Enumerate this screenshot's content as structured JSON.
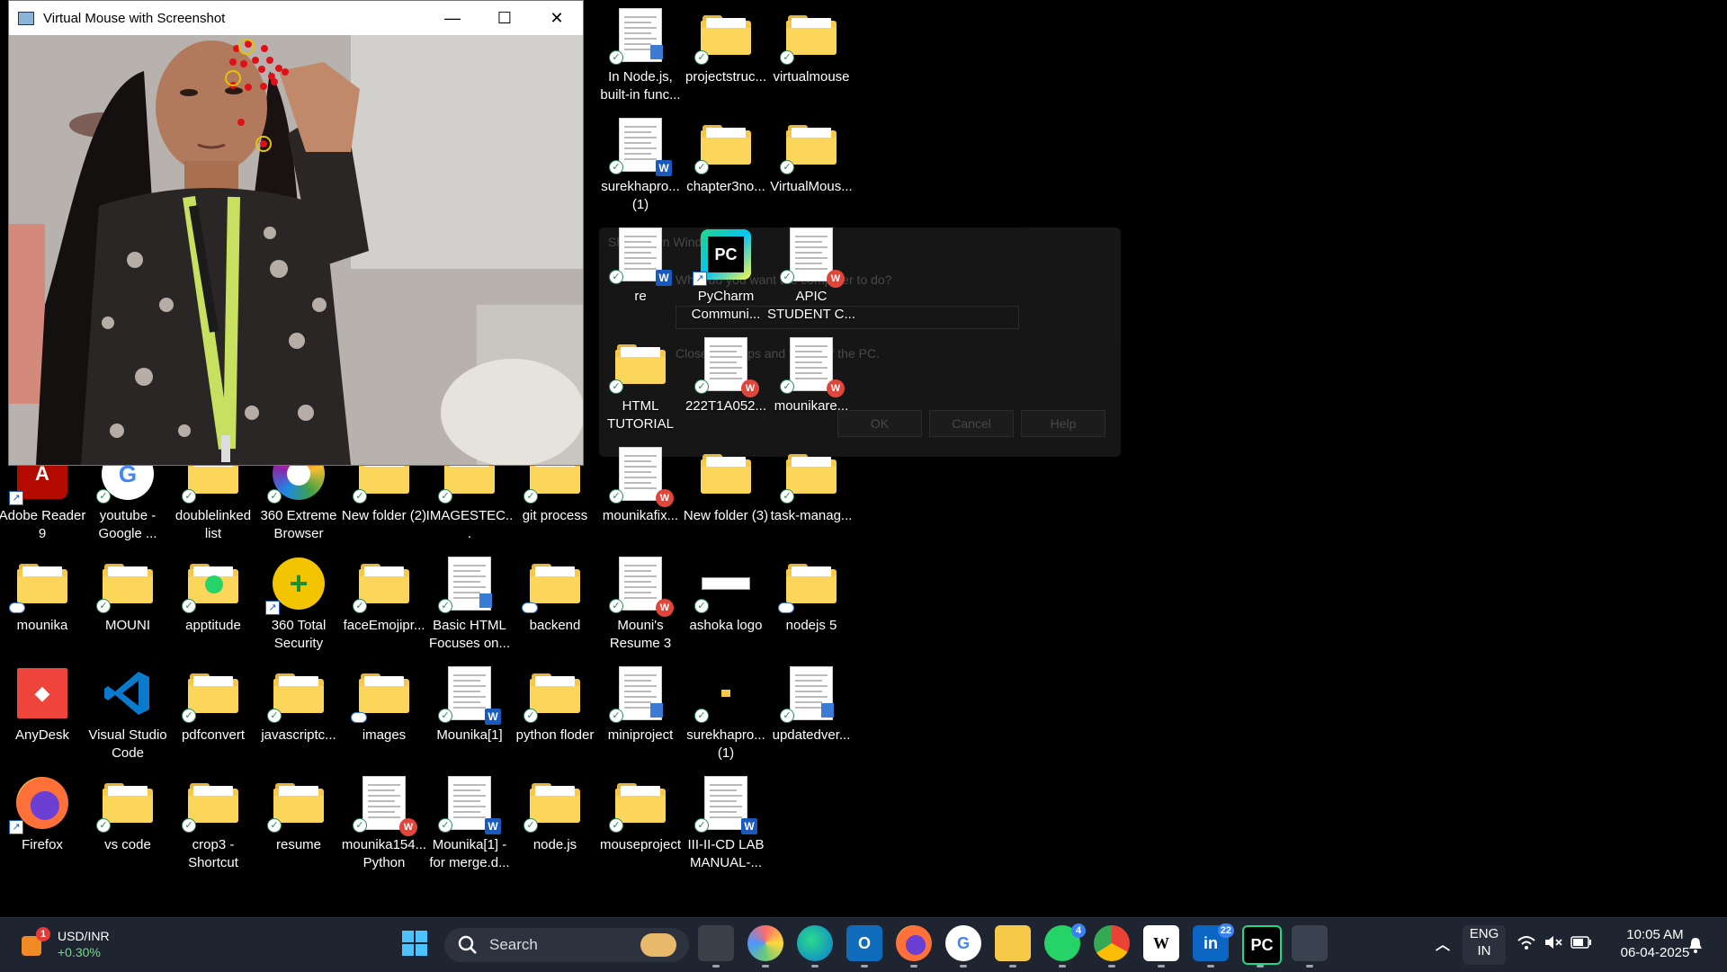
{
  "window": {
    "title": "Virtual Mouse with Screenshot",
    "buttons": {
      "minimize": "—",
      "maximize": "☐",
      "close": "✕"
    }
  },
  "dialog": {
    "title": "Shut Down Windows",
    "question": "What do you want the computer to do?",
    "description": "Closes all apps and turns off the PC.",
    "ok": "OK",
    "cancel": "Cancel",
    "help": "Help"
  },
  "desktop_icons": [
    {
      "label": "In Node.js, built-in func...",
      "kind": "doc-note",
      "status": "check"
    },
    {
      "label": "projectstruc...",
      "kind": "folder",
      "status": "check"
    },
    {
      "label": "virtualmouse",
      "kind": "folder",
      "status": "check"
    },
    {
      "label": "surekhapro... (1)",
      "kind": "doc-word",
      "status": "check"
    },
    {
      "label": "chapter3no...",
      "kind": "folder",
      "status": "check"
    },
    {
      "label": "VirtualMous...",
      "kind": "folder",
      "status": "check"
    },
    {
      "label": "re",
      "kind": "doc-word",
      "status": "check"
    },
    {
      "label": "PyCharm Communi...",
      "kind": "pycharm",
      "status": "shortcut"
    },
    {
      "label": "APIC STUDENT C...",
      "kind": "doc-wps",
      "status": "check"
    },
    {
      "label": "HTML TUTORIAL",
      "kind": "folder",
      "status": "check"
    },
    {
      "label": "222T1A052...",
      "kind": "doc-wps",
      "status": "check"
    },
    {
      "label": "mounikare...",
      "kind": "doc-wps",
      "status": "check"
    },
    {
      "label": "Adobe Reader 9",
      "kind": "adobe",
      "status": "shortcut"
    },
    {
      "label": "youtube - Google ...",
      "kind": "google",
      "status": "check"
    },
    {
      "label": "doublelinked list",
      "kind": "folder",
      "status": "check"
    },
    {
      "label": "360 Extreme Browser",
      "kind": "browser360",
      "status": "check"
    },
    {
      "label": "New folder (2)",
      "kind": "folder",
      "status": "check"
    },
    {
      "label": "IMAGESTEC...",
      "kind": "folder",
      "status": "check"
    },
    {
      "label": "git process",
      "kind": "folder",
      "status": "check"
    },
    {
      "label": "mounikafix...",
      "kind": "doc-wps",
      "status": "check"
    },
    {
      "label": "New folder (3)",
      "kind": "folder",
      "status": "none"
    },
    {
      "label": "task-manag...",
      "kind": "folder",
      "status": "check"
    },
    {
      "label": "mounika",
      "kind": "folder",
      "status": "cloud"
    },
    {
      "label": "MOUNI",
      "kind": "folder",
      "status": "check"
    },
    {
      "label": "apptitude",
      "kind": "folder-whatsapp",
      "status": "check"
    },
    {
      "label": "360 Total Security",
      "kind": "total360",
      "status": "shortcut"
    },
    {
      "label": "faceEmojipr...",
      "kind": "folder",
      "status": "check"
    },
    {
      "label": "Basic HTML Focuses on...",
      "kind": "doc-note",
      "status": "check"
    },
    {
      "label": "backend",
      "kind": "folder",
      "status": "cloud"
    },
    {
      "label": "Mouni's Resume 3",
      "kind": "doc-wps",
      "status": "check"
    },
    {
      "label": "ashoka logo",
      "kind": "image",
      "status": "check"
    },
    {
      "label": "nodejs 5",
      "kind": "folder",
      "status": "cloud"
    },
    {
      "label": "AnyDesk",
      "kind": "anydesk",
      "status": "none"
    },
    {
      "label": "Visual Studio Code",
      "kind": "vscode",
      "status": "none"
    },
    {
      "label": "pdfconvert",
      "kind": "folder",
      "status": "check"
    },
    {
      "label": "javascriptc...",
      "kind": "folder",
      "status": "check"
    },
    {
      "label": "images",
      "kind": "folder",
      "status": "cloud"
    },
    {
      "label": "Mounika[1]",
      "kind": "doc-word",
      "status": "check"
    },
    {
      "label": "python floder",
      "kind": "folder",
      "status": "check"
    },
    {
      "label": "miniproject",
      "kind": "doc-note",
      "status": "check"
    },
    {
      "label": "surekhapro... (1)",
      "kind": "tiny-folder",
      "status": "check"
    },
    {
      "label": "updatedver...",
      "kind": "doc-note",
      "status": "check"
    },
    {
      "label": "Firefox",
      "kind": "firefox",
      "status": "shortcut"
    },
    {
      "label": "vs code",
      "kind": "folder",
      "status": "check"
    },
    {
      "label": "crop3 - Shortcut",
      "kind": "folder",
      "status": "check"
    },
    {
      "label": "resume",
      "kind": "folder",
      "status": "check"
    },
    {
      "label": "mounika154... Python",
      "kind": "doc-wps",
      "status": "check"
    },
    {
      "label": "Mounika[1] - for merge.d...",
      "kind": "doc-word",
      "status": "check"
    },
    {
      "label": "node.js",
      "kind": "folder",
      "status": "check"
    },
    {
      "label": "mouseproject",
      "kind": "folder",
      "status": "check"
    },
    {
      "label": "III-II-CD LAB MANUAL-...",
      "kind": "doc-word",
      "status": "check"
    }
  ],
  "taskbar": {
    "widget": {
      "symbol": "USD/INR",
      "change": "+0.30%",
      "badge": "1"
    },
    "search_placeholder": "Search",
    "apps": [
      {
        "name": "start-icon",
        "label": ""
      },
      {
        "name": "task-view-icon",
        "label": ""
      },
      {
        "name": "copilot-icon",
        "label": ""
      },
      {
        "name": "edge-icon",
        "label": ""
      },
      {
        "name": "outlook-icon",
        "label": "O"
      },
      {
        "name": "firefox-icon",
        "label": ""
      },
      {
        "name": "google-icon",
        "label": "G"
      },
      {
        "name": "file-explorer-icon",
        "label": ""
      },
      {
        "name": "whatsapp-icon",
        "label": "",
        "badge": "4"
      },
      {
        "name": "chrome-icon",
        "label": ""
      },
      {
        "name": "wikipedia-icon",
        "label": "W"
      },
      {
        "name": "linkedin-icon",
        "label": "in",
        "badge": "22"
      },
      {
        "name": "pycharm-icon",
        "label": "PC"
      },
      {
        "name": "python-app-icon",
        "label": ""
      }
    ],
    "tray": {
      "lang": "ENG",
      "region": "IN",
      "time": "10:05 AM",
      "date": "06-04-2025"
    }
  },
  "colors": {
    "desktop_bg": "#000000",
    "taskbar_bg": "#1f2530",
    "folder": "#f7c948",
    "accent": "#3b82f6"
  }
}
